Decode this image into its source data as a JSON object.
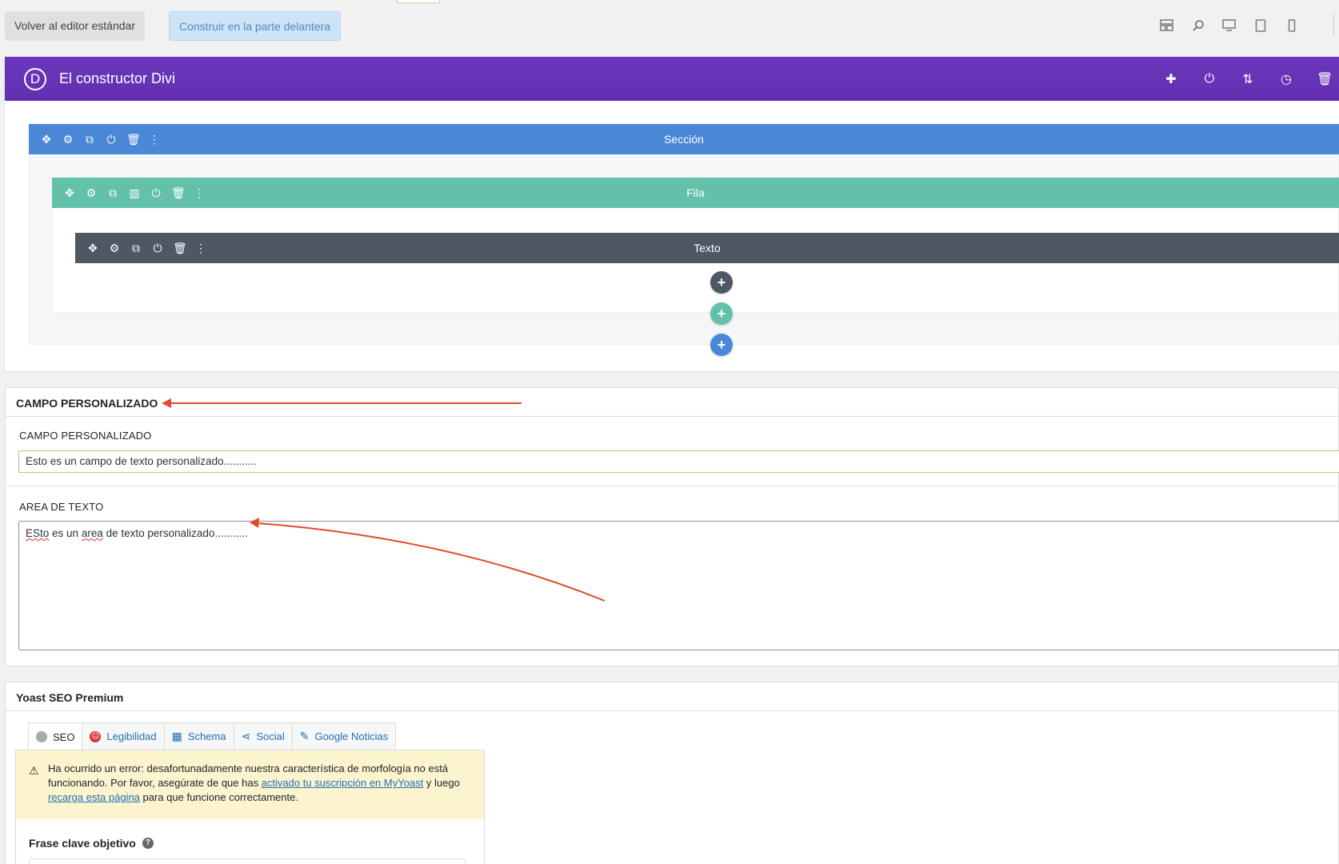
{
  "toolbar": {
    "standard_editor": "Volver al editor estándar",
    "frontend_builder": "Construir en la parte delantera",
    "view_icons": [
      "layout-icon",
      "zoom-icon",
      "desktop-icon",
      "tablet-icon",
      "phone-icon"
    ]
  },
  "divi": {
    "logo": "D",
    "title": "El constructor Divi",
    "actions": [
      "add-icon",
      "power-icon",
      "sort-icon",
      "history-icon",
      "trash-icon"
    ],
    "accent": "#6534b6",
    "section": {
      "label": "Sección",
      "color": "#4a87d6"
    },
    "row": {
      "label": "Fila",
      "color": "#63c1aa"
    },
    "module": {
      "label": "Texto",
      "color": "#4e5764"
    }
  },
  "custom_field_box": {
    "title": "CAMPO PERSONALIZADO",
    "field1": {
      "label": "CAMPO PERSONALIZADO",
      "value": "Esto es un campo de texto personalizado..........."
    },
    "field2": {
      "label": "AREA DE TEXTO",
      "value_word1": "ESto",
      "value_word2": " es un ",
      "value_word3": "area",
      "value_word4": " de texto personalizado..........."
    }
  },
  "yoast": {
    "title": "Yoast SEO Premium",
    "tabs": [
      "SEO",
      "Legibilidad",
      "Schema",
      "Social",
      "Google Noticias"
    ],
    "warning": {
      "text1": "Ha ocurrido un error: desafortunadamente nuestra característica de morfología no está funcionando. Por favor, asegúrate de que has ",
      "link1": "activado tu suscripción en MyYoast",
      "text2": " y luego ",
      "link2": "recarga esta página",
      "text3": " para que funcione correctamente."
    },
    "keyphrase_label": "Frase clave objetivo"
  }
}
